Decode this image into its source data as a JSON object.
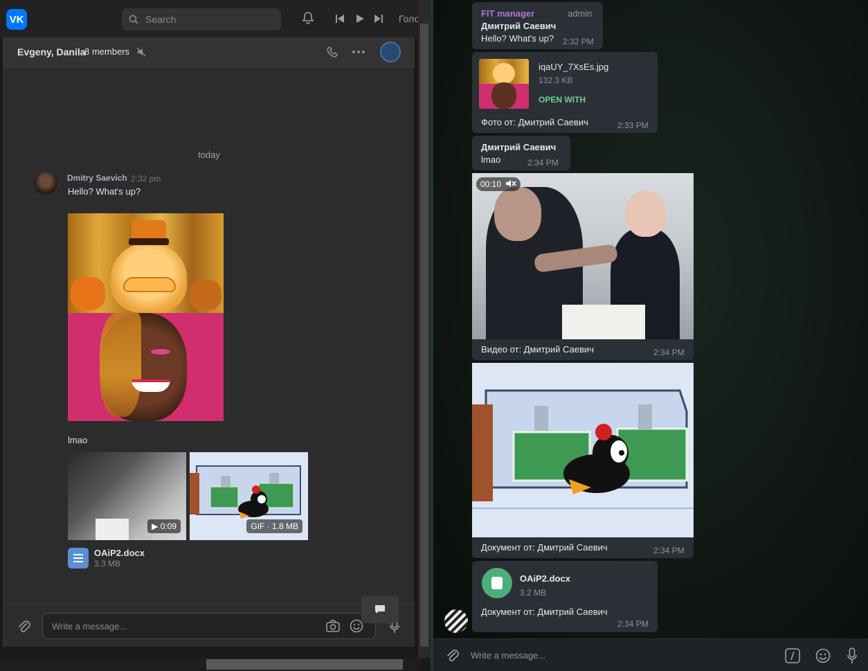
{
  "vk": {
    "logo": "VK",
    "search_placeholder": "Search",
    "topbar_text": "Голо",
    "chat": {
      "title": "Evgeny, Danila",
      "members": "8 members"
    },
    "date_divider": "today",
    "message": {
      "author": "Dmitry Saevich",
      "time": "2:32 pm",
      "text1": "Hello? What's up?",
      "text2": "lmao",
      "video_badge": "▶ 0:09",
      "gif_badge": "GIF · 1.8 MB",
      "doc_name": "OAiP2.docx",
      "doc_size": "3.3 MB"
    },
    "compose_placeholder": "Write a message...",
    "colors": {
      "accent": "#0077ff",
      "bg": "#2c2c2d"
    }
  },
  "tg": {
    "msg1": {
      "role": "FIT manager",
      "badge": "admin",
      "author": "Дмитрий Саевич",
      "text": "Hello? What's up?",
      "time": "2:32 PM"
    },
    "msg2": {
      "file_name": "iqaUY_7XsEs.jpg",
      "file_size": "132.3 KB",
      "action": "OPEN WITH",
      "caption": "Фото от: Дмитрий Саевич",
      "time": "2:33 PM"
    },
    "msg3": {
      "author": "Дмитрий Саевич",
      "text": "lmao",
      "time": "2:34 PM"
    },
    "msg4": {
      "duration": "00:10",
      "caption": "Видео от: Дмитрий Саевич",
      "time": "2:34 PM"
    },
    "msg5": {
      "caption": "Документ от: Дмитрий Саевич",
      "time": "2:34 PM"
    },
    "msg6": {
      "file_name": "OAiP2.docx",
      "file_size": "3.2 MB",
      "caption": "Документ от: Дмитрий Саевич",
      "time": "2:34 PM"
    },
    "compose_placeholder": "Write a message...",
    "colors": {
      "accent_green": "#4caf7a",
      "purple": "#b173d9"
    }
  }
}
